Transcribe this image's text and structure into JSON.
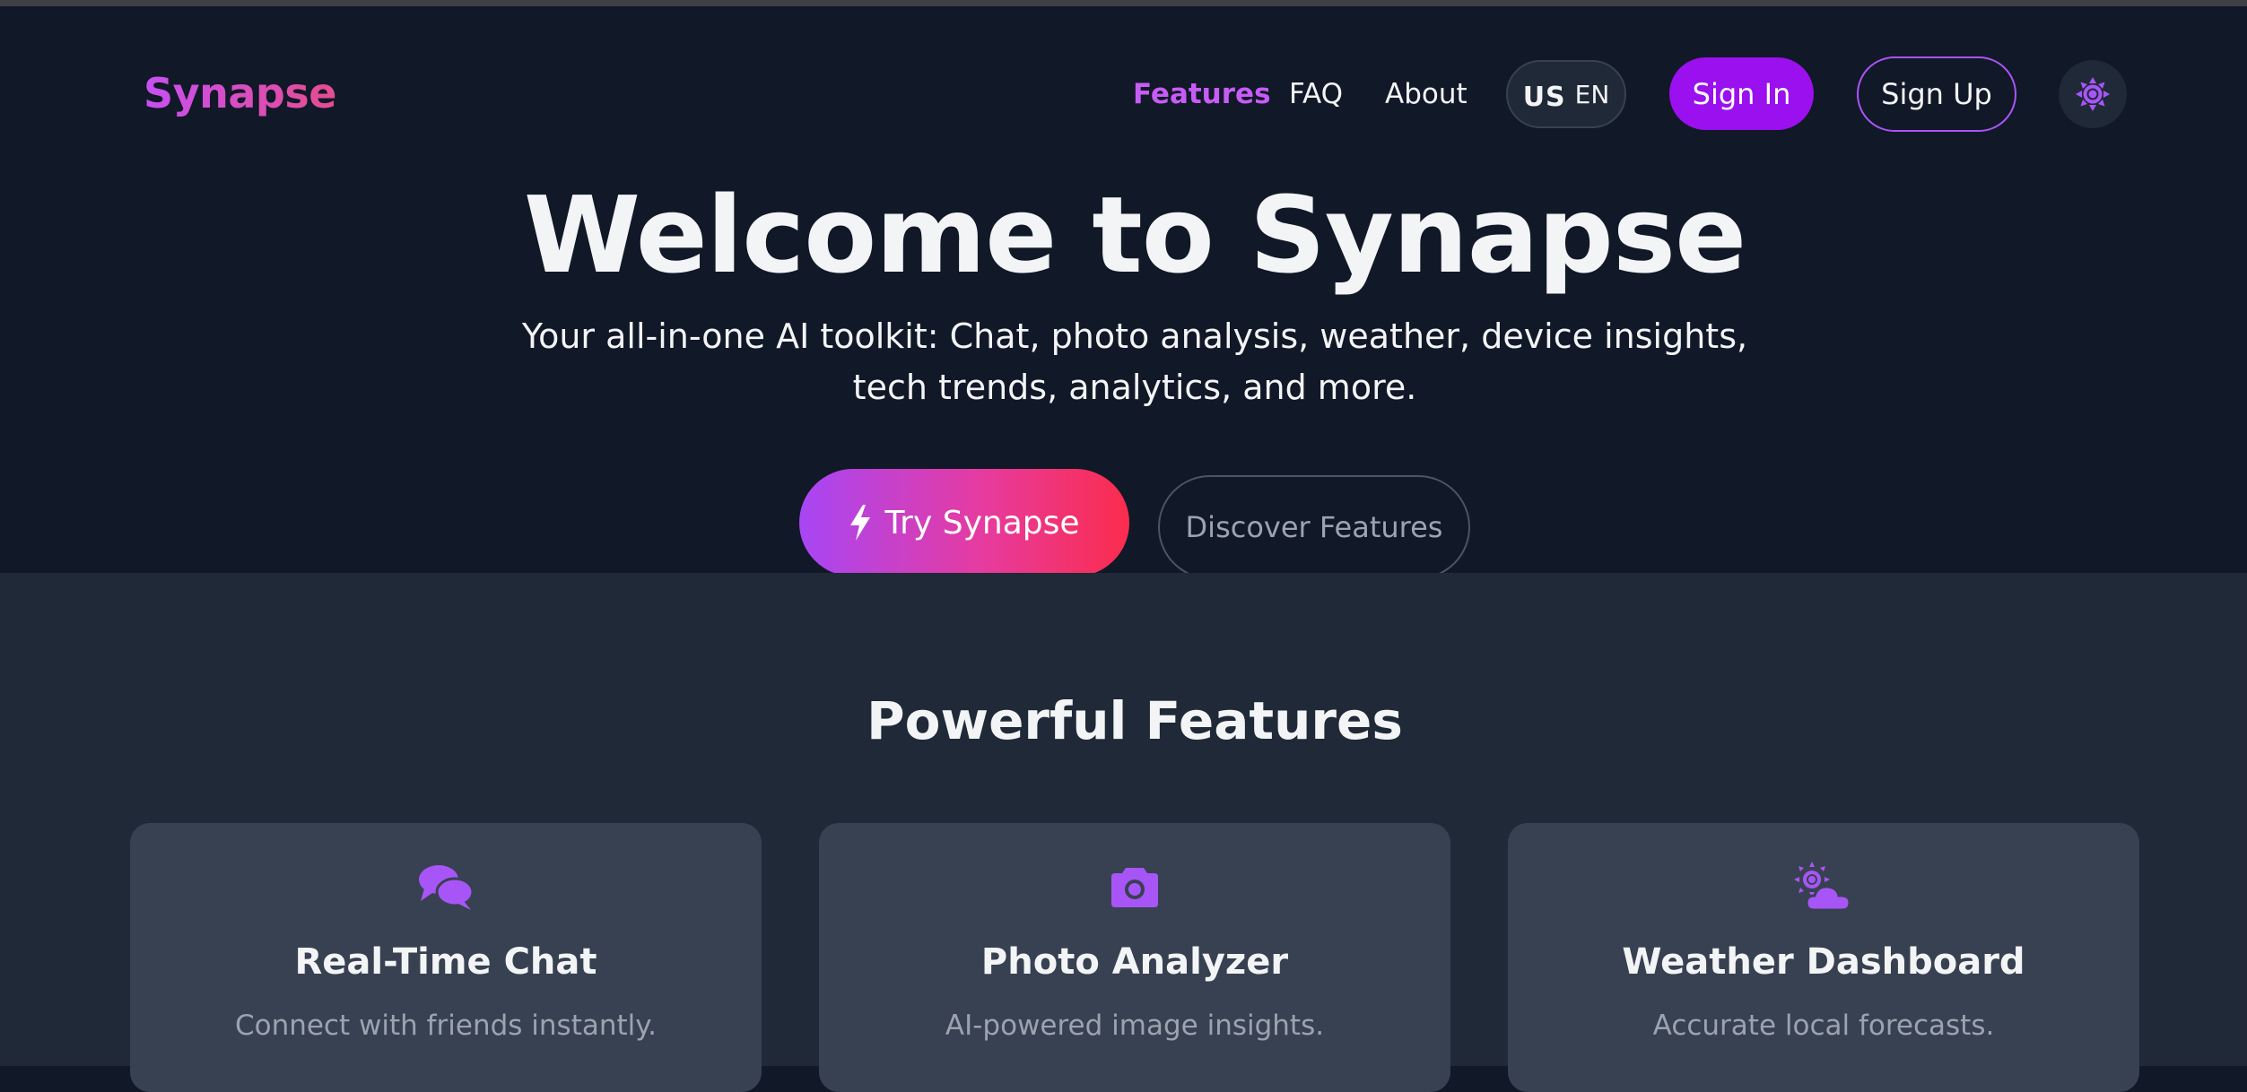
{
  "brand": {
    "logo_text": "Synapse"
  },
  "nav": {
    "links": [
      {
        "label": "Features",
        "active": true
      },
      {
        "label": "FAQ",
        "active": false
      },
      {
        "label": "About",
        "active": false
      }
    ],
    "language": {
      "flag": "US",
      "code": "EN"
    },
    "sign_in_label": "Sign In",
    "sign_up_label": "Sign Up",
    "theme_icon": "sun-icon"
  },
  "hero": {
    "title": "Welcome to Synapse",
    "subtitle": "Your all-in-one AI toolkit: Chat, photo analysis, weather, device insights, tech trends, analytics, and more.",
    "primary_cta": "Try Synapse",
    "primary_cta_icon": "bolt-icon",
    "secondary_cta": "Discover Features"
  },
  "features": {
    "heading": "Powerful Features",
    "cards": [
      {
        "icon": "chat-bubbles-icon",
        "title": "Real-Time Chat",
        "description": "Connect with friends instantly."
      },
      {
        "icon": "camera-icon",
        "title": "Photo Analyzer",
        "description": "AI-powered image insights."
      },
      {
        "icon": "cloud-sun-icon",
        "title": "Weather Dashboard",
        "description": "Accurate local forecasts."
      }
    ]
  },
  "colors": {
    "accent": "#a855f7",
    "accent_strong": "#9a10ef",
    "gradient_start": "#a746f5",
    "gradient_end": "#fb2c4d",
    "hero_bg": "#111827",
    "section_bg": "#1f2937",
    "card_bg": "#374151"
  }
}
